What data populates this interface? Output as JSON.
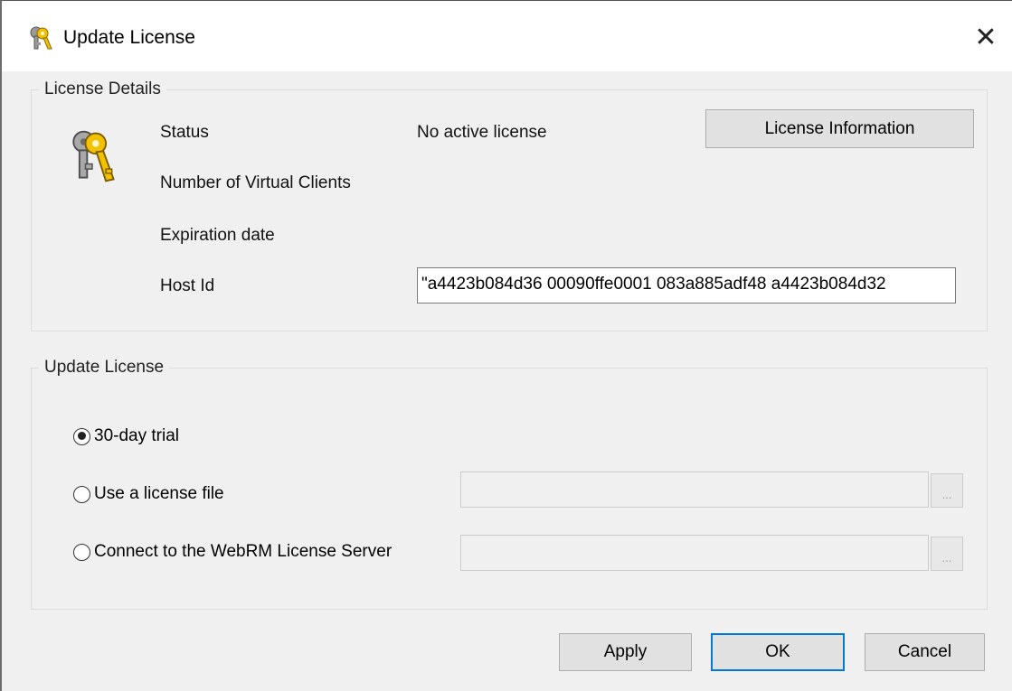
{
  "window": {
    "title": "Update License",
    "close_glyph": "✕",
    "title_icon": "keys-icon"
  },
  "license_details": {
    "group_label": "License Details",
    "big_icon": "keys-icon",
    "status_label": "Status",
    "status_value": "No active license",
    "virtual_clients_label": "Number of Virtual Clients",
    "expiration_label": "Expiration date",
    "host_id_label": "Host Id",
    "host_id_value": "\"a4423b084d36 00090ffe0001 083a885adf48 a4423b084d32",
    "license_info_button": "License Information"
  },
  "update_license": {
    "group_label": "Update License",
    "options": [
      {
        "label": "30-day trial",
        "checked": true
      },
      {
        "label": "Use a license file",
        "checked": false
      },
      {
        "label": "Connect to the WebRM License Server",
        "checked": false
      }
    ],
    "license_file_value": "",
    "server_value": "",
    "browse_glyph": "..."
  },
  "buttons": {
    "apply": "Apply",
    "ok": "OK",
    "cancel": "Cancel"
  },
  "colors": {
    "dialog_bg": "#f0f0f0",
    "accent": "#0078d7",
    "key_gold": "#e8b30a"
  }
}
